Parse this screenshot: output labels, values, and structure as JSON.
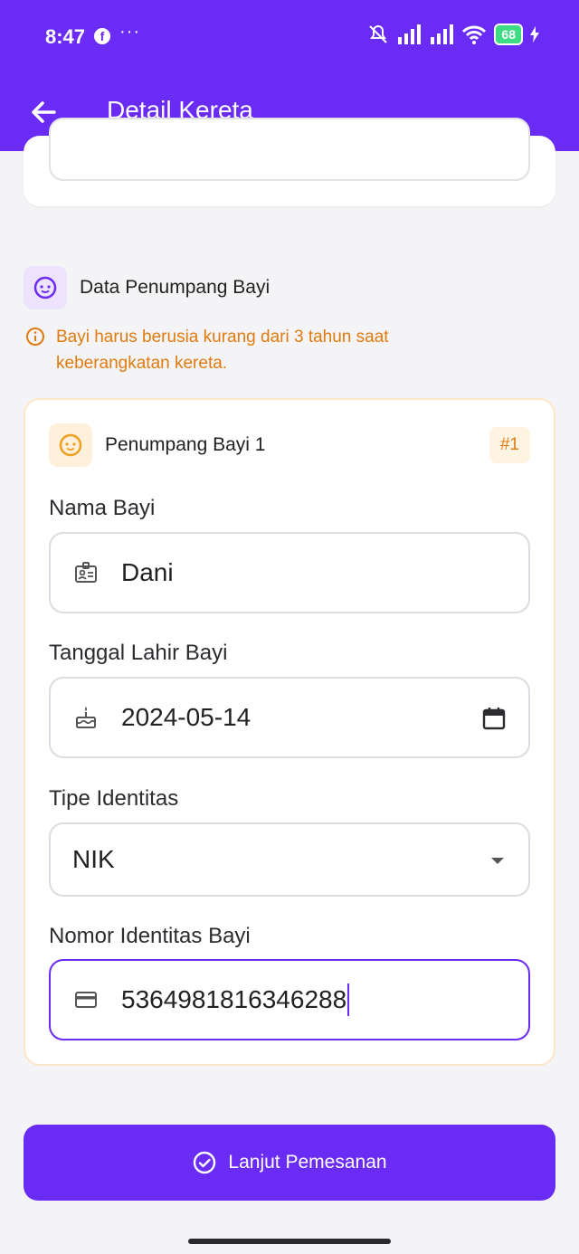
{
  "status_bar": {
    "time": "8:47",
    "battery": "68"
  },
  "app_bar": {
    "title": "Detail Kereta"
  },
  "section": {
    "title": "Data Penumpang Bayi",
    "warning": "Bayi harus berusia kurang dari 3 tahun saat keberangkatan kereta."
  },
  "passenger": {
    "title": "Penumpang Bayi 1",
    "badge": "#1",
    "fields": {
      "name": {
        "label": "Nama Bayi",
        "value": "Dani"
      },
      "dob": {
        "label": "Tanggal Lahir Bayi",
        "value": "2024-05-14"
      },
      "id_type": {
        "label": "Tipe Identitas",
        "value": "NIK"
      },
      "id_number": {
        "label": "Nomor Identitas Bayi",
        "value": "5364981816346288"
      }
    }
  },
  "cta": {
    "label": "Lanjut Pemesanan"
  },
  "colors": {
    "primary": "#6A2BF5",
    "warning": "#E07B10",
    "card_border": "#FDE6C8"
  }
}
